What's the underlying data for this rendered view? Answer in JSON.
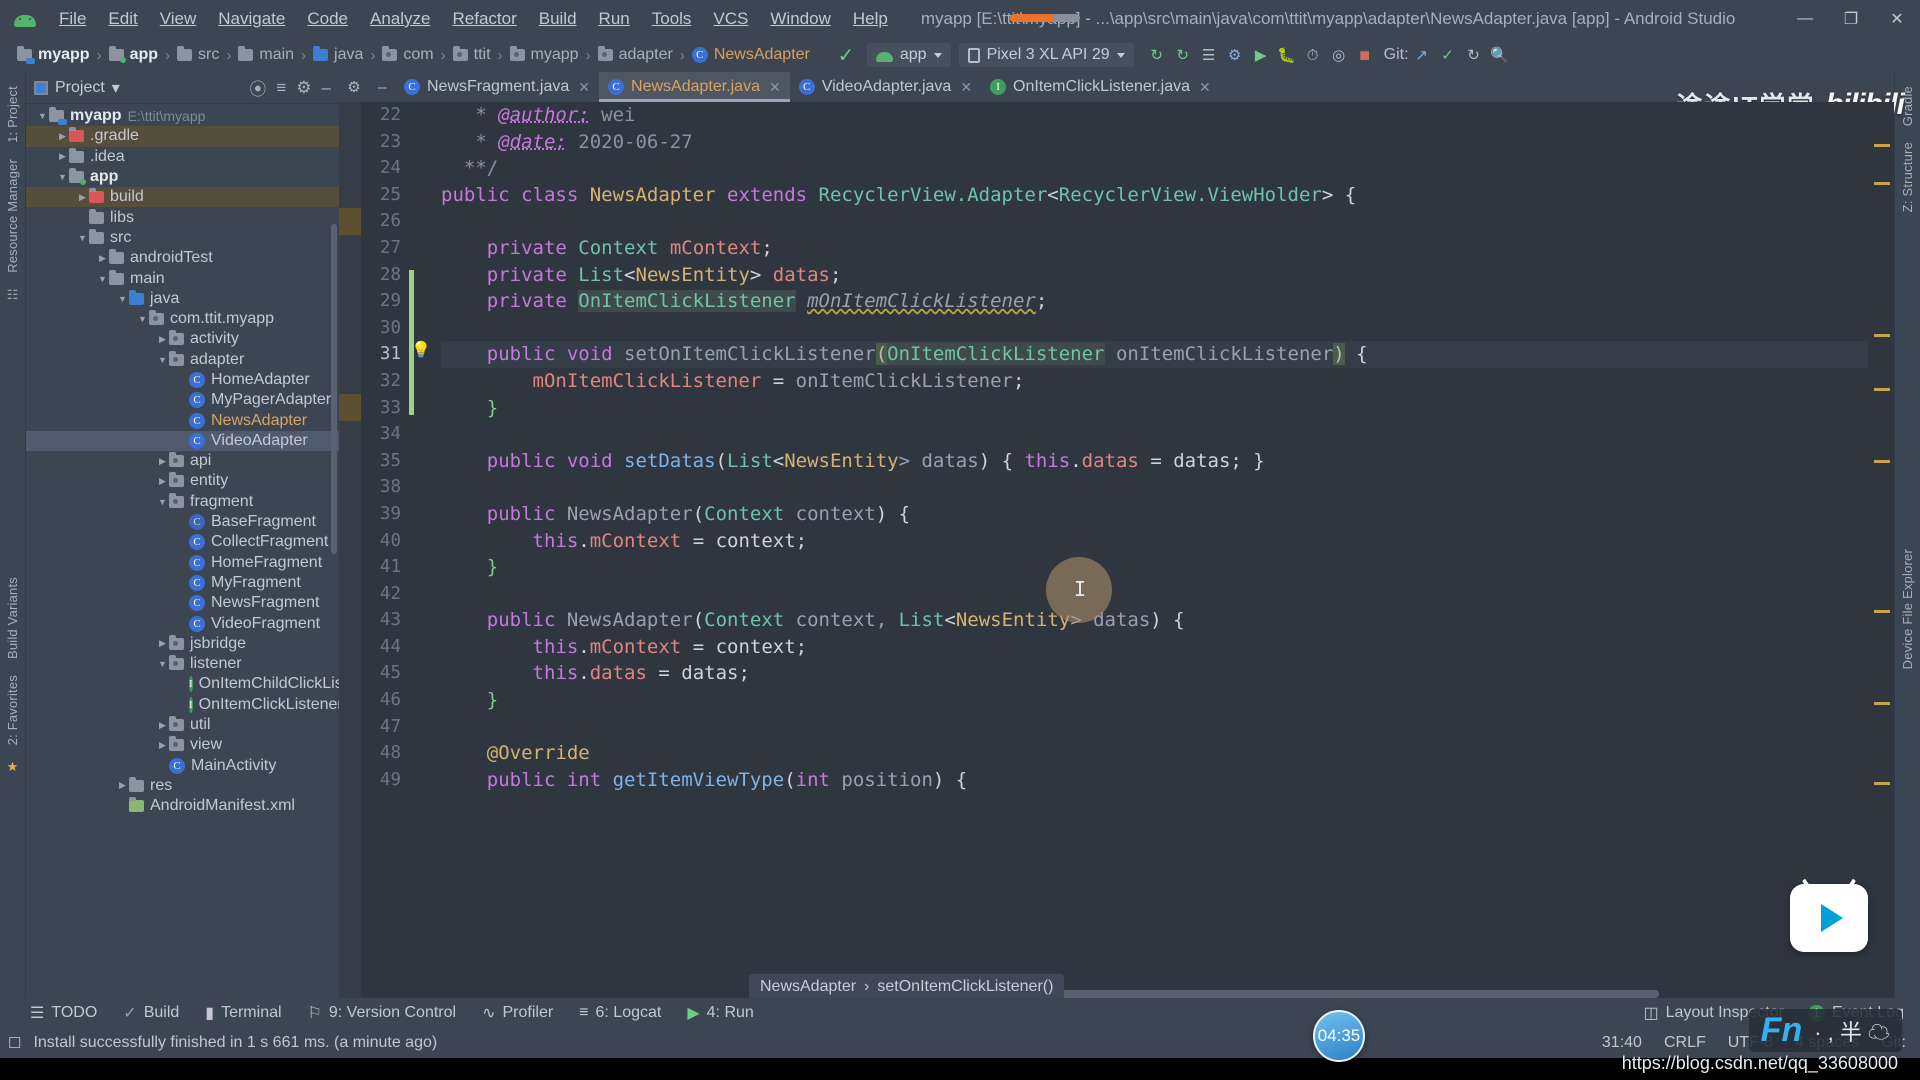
{
  "window": {
    "title": "myapp [E:\\ttit\\myapp] - ...\\app\\src\\main\\java\\com\\ttit\\myapp\\adapter\\NewsAdapter.java [app] - Android Studio",
    "minimize": "—",
    "maximize": "❐",
    "close": "✕",
    "app_icon": "android-icon"
  },
  "menu": [
    {
      "label": "File"
    },
    {
      "label": "Edit"
    },
    {
      "label": "View"
    },
    {
      "label": "Navigate"
    },
    {
      "label": "Code"
    },
    {
      "label": "Analyze"
    },
    {
      "label": "Refactor"
    },
    {
      "label": "Build"
    },
    {
      "label": "Run"
    },
    {
      "label": "Tools"
    },
    {
      "label": "VCS"
    },
    {
      "label": "Window"
    },
    {
      "label": "Help"
    }
  ],
  "navbar": {
    "crumbs": [
      {
        "label": "myapp",
        "icon": "project-folder-icon"
      },
      {
        "label": "app",
        "icon": "module-folder-icon"
      },
      {
        "label": "src",
        "icon": "folder-icon"
      },
      {
        "label": "main",
        "icon": "folder-icon"
      },
      {
        "label": "java",
        "icon": "source-folder-icon"
      },
      {
        "label": "com",
        "icon": "package-icon"
      },
      {
        "label": "ttit",
        "icon": "package-icon"
      },
      {
        "label": "myapp",
        "icon": "package-icon"
      },
      {
        "label": "adapter",
        "icon": "package-icon"
      },
      {
        "label": "NewsAdapter",
        "icon": "class-icon"
      }
    ],
    "separator": "›",
    "build_config": "app",
    "device": "Pixel 3 XL API 29",
    "git_label": "Git:",
    "icons": [
      "make-project-icon",
      "sync-gradle-icon",
      "avd-manager-icon",
      "sdk-manager-icon",
      "run-icon",
      "debug-icon",
      "profile-icon",
      "attach-debugger-icon",
      "stop-icon",
      "search-everywhere-icon",
      "settings-icon"
    ]
  },
  "tabs": [
    {
      "label": "NewsFragment.java",
      "icon": "class-icon",
      "active": false
    },
    {
      "label": "NewsAdapter.java",
      "icon": "class-icon",
      "active": true
    },
    {
      "label": "VideoAdapter.java",
      "icon": "class-icon",
      "active": false
    },
    {
      "label": "OnItemClickListener.java",
      "icon": "interface-icon",
      "active": false
    }
  ],
  "project_panel": {
    "title": "Project",
    "dropdown_caret": "▾",
    "actions": [
      "locate-icon",
      "collapse-all-icon",
      "settings-icon",
      "hide-icon"
    ],
    "tree": [
      {
        "depth": 0,
        "arrow": "▼",
        "label": "myapp",
        "path": "E:\\ttit\\myapp",
        "icon": "project-folder-icon",
        "bold": true
      },
      {
        "depth": 1,
        "arrow": "▶",
        "label": ".gradle",
        "icon": "excluded-folder-icon",
        "state": "build-hl"
      },
      {
        "depth": 1,
        "arrow": "▶",
        "label": ".idea",
        "icon": "folder-icon"
      },
      {
        "depth": 1,
        "arrow": "▼",
        "label": "app",
        "icon": "module-folder-icon",
        "bold": true
      },
      {
        "depth": 2,
        "arrow": "▶",
        "label": "build",
        "icon": "excluded-folder-icon",
        "state": "build-hl"
      },
      {
        "depth": 2,
        "arrow": "",
        "label": "libs",
        "icon": "folder-icon"
      },
      {
        "depth": 2,
        "arrow": "▼",
        "label": "src",
        "icon": "folder-icon"
      },
      {
        "depth": 3,
        "arrow": "▶",
        "label": "androidTest",
        "icon": "folder-icon"
      },
      {
        "depth": 3,
        "arrow": "▼",
        "label": "main",
        "icon": "folder-icon"
      },
      {
        "depth": 4,
        "arrow": "▼",
        "label": "java",
        "icon": "source-folder-icon"
      },
      {
        "depth": 5,
        "arrow": "▼",
        "label": "com.ttit.myapp",
        "icon": "package-icon"
      },
      {
        "depth": 6,
        "arrow": "▶",
        "label": "activity",
        "icon": "package-icon"
      },
      {
        "depth": 6,
        "arrow": "▼",
        "label": "adapter",
        "icon": "package-icon"
      },
      {
        "depth": 7,
        "arrow": "",
        "label": "HomeAdapter",
        "icon": "class-icon"
      },
      {
        "depth": 7,
        "arrow": "",
        "label": "MyPagerAdapter",
        "icon": "class-icon"
      },
      {
        "depth": 7,
        "arrow": "",
        "label": "NewsAdapter",
        "icon": "class-icon",
        "state": "open-file"
      },
      {
        "depth": 7,
        "arrow": "",
        "label": "VideoAdapter",
        "icon": "class-icon",
        "state": "selected"
      },
      {
        "depth": 6,
        "arrow": "▶",
        "label": "api",
        "icon": "package-icon"
      },
      {
        "depth": 6,
        "arrow": "▶",
        "label": "entity",
        "icon": "package-icon"
      },
      {
        "depth": 6,
        "arrow": "▼",
        "label": "fragment",
        "icon": "package-icon"
      },
      {
        "depth": 7,
        "arrow": "",
        "label": "BaseFragment",
        "icon": "abstract-class-icon"
      },
      {
        "depth": 7,
        "arrow": "",
        "label": "CollectFragment",
        "icon": "class-icon"
      },
      {
        "depth": 7,
        "arrow": "",
        "label": "HomeFragment",
        "icon": "class-icon"
      },
      {
        "depth": 7,
        "arrow": "",
        "label": "MyFragment",
        "icon": "class-icon"
      },
      {
        "depth": 7,
        "arrow": "",
        "label": "NewsFragment",
        "icon": "class-icon"
      },
      {
        "depth": 7,
        "arrow": "",
        "label": "VideoFragment",
        "icon": "class-icon"
      },
      {
        "depth": 6,
        "arrow": "▶",
        "label": "jsbridge",
        "icon": "package-icon"
      },
      {
        "depth": 6,
        "arrow": "▼",
        "label": "listener",
        "icon": "package-icon"
      },
      {
        "depth": 7,
        "arrow": "",
        "label": "OnItemChildClickListener",
        "icon": "interface-icon"
      },
      {
        "depth": 7,
        "arrow": "",
        "label": "OnItemClickListener",
        "icon": "interface-icon"
      },
      {
        "depth": 6,
        "arrow": "▶",
        "label": "util",
        "icon": "package-icon"
      },
      {
        "depth": 6,
        "arrow": "▶",
        "label": "view",
        "icon": "package-icon"
      },
      {
        "depth": 6,
        "arrow": "",
        "label": "MainActivity",
        "icon": "class-icon"
      },
      {
        "depth": 4,
        "arrow": "▶",
        "label": "res",
        "icon": "folder-icon"
      },
      {
        "depth": 4,
        "arrow": "",
        "label": "AndroidManifest.xml",
        "icon": "manifest-icon"
      }
    ]
  },
  "left_rail": [
    "1: Project",
    "Resource Manager",
    "Build Variants",
    "2: Favorites"
  ],
  "right_rail": [
    "Gradle",
    "Z: Structure",
    "Device File Explorer"
  ],
  "editor": {
    "first_line": 22,
    "lines": [
      {
        "n": 22,
        "segs": [
          {
            "t": "   * ",
            "c": "cmt"
          },
          {
            "t": "@author:",
            "c": "tag"
          },
          {
            "t": " wei",
            "c": "cmt"
          }
        ]
      },
      {
        "n": 23,
        "segs": [
          {
            "t": "   * ",
            "c": "cmt"
          },
          {
            "t": "@date:",
            "c": "tag"
          },
          {
            "t": " 2020-06-27",
            "c": "cmt"
          }
        ]
      },
      {
        "n": 24,
        "segs": [
          {
            "t": "  **/",
            "c": "cmt"
          }
        ]
      },
      {
        "n": 25,
        "segs": [
          {
            "t": "public class ",
            "c": "kw"
          },
          {
            "t": "NewsAdapter",
            "c": "cls"
          },
          {
            "t": " extends ",
            "c": "kw"
          },
          {
            "t": "RecyclerView.Adapter",
            "c": "typ"
          },
          {
            "t": "<",
            "c": "punct"
          },
          {
            "t": "RecyclerView.ViewHolder",
            "c": "typ"
          },
          {
            "t": "> {",
            "c": "punct"
          }
        ]
      },
      {
        "n": 26,
        "segs": []
      },
      {
        "n": 27,
        "segs": [
          {
            "t": "    private ",
            "c": "kw"
          },
          {
            "t": "Context",
            "c": "typ"
          },
          {
            "t": " ",
            "c": "punct"
          },
          {
            "t": "mContext",
            "c": "fld"
          },
          {
            "t": ";",
            "c": "punct"
          }
        ]
      },
      {
        "n": 28,
        "segs": [
          {
            "t": "    private ",
            "c": "kw"
          },
          {
            "t": "List",
            "c": "typ"
          },
          {
            "t": "<",
            "c": "punct"
          },
          {
            "t": "NewsEntity",
            "c": "cls"
          },
          {
            "t": "> ",
            "c": "punct"
          },
          {
            "t": "datas",
            "c": "fld"
          },
          {
            "t": ";",
            "c": "punct"
          }
        ]
      },
      {
        "n": 29,
        "segs": [
          {
            "t": "    private ",
            "c": "kw"
          },
          {
            "t": "OnItemClickListener",
            "c": "typ hl-ident"
          },
          {
            "t": " ",
            "c": "punct"
          },
          {
            "t": "mOnItemClickListener",
            "c": "varit"
          },
          {
            "t": ";",
            "c": "punct"
          }
        ]
      },
      {
        "n": 30,
        "segs": []
      },
      {
        "n": 31,
        "segs": [
          {
            "t": "    public void ",
            "c": "kw"
          },
          {
            "t": "setOnItemClickListener",
            "c": "fn"
          },
          {
            "t": "(",
            "c": "hl-paren"
          },
          {
            "t": "OnItemClickListener",
            "c": "typ hl-ident"
          },
          {
            "t": " onItemClickListener",
            "c": "var"
          },
          {
            "t": ")",
            "c": "hl-paren"
          },
          {
            "t": " {",
            "c": "punct"
          }
        ],
        "current": true
      },
      {
        "n": 32,
        "segs": [
          {
            "t": "        ",
            "c": "punct"
          },
          {
            "t": "mOnItemClickListener",
            "c": "fld"
          },
          {
            "t": " = ",
            "c": "punct"
          },
          {
            "t": "onItemClickListener",
            "c": "var"
          },
          {
            "t": ";",
            "c": "punct"
          }
        ]
      },
      {
        "n": 33,
        "segs": [
          {
            "t": "    }",
            "c": "green"
          }
        ]
      },
      {
        "n": 34,
        "segs": []
      },
      {
        "n": 35,
        "segs": [
          {
            "t": "    public void ",
            "c": "kw"
          },
          {
            "t": "setDatas",
            "c": "fn2"
          },
          {
            "t": "(",
            "c": "punct"
          },
          {
            "t": "List",
            "c": "typ"
          },
          {
            "t": "<",
            "c": "punct"
          },
          {
            "t": "NewsEntity",
            "c": "cls"
          },
          {
            "t": "> datas",
            "c": "var"
          },
          {
            "t": ") { ",
            "c": "punct"
          },
          {
            "t": "this",
            "c": "kw"
          },
          {
            "t": ".",
            "c": "punct"
          },
          {
            "t": "datas",
            "c": "fld"
          },
          {
            "t": " = datas; }",
            "c": "punct"
          }
        ]
      },
      {
        "n": 38,
        "segs": []
      },
      {
        "n": 39,
        "segs": [
          {
            "t": "    public ",
            "c": "kw"
          },
          {
            "t": "NewsAdapter",
            "c": "fn"
          },
          {
            "t": "(",
            "c": "punct"
          },
          {
            "t": "Context",
            "c": "typ"
          },
          {
            "t": " context",
            "c": "var"
          },
          {
            "t": ") {",
            "c": "punct"
          }
        ]
      },
      {
        "n": 40,
        "segs": [
          {
            "t": "        ",
            "c": "punct"
          },
          {
            "t": "this",
            "c": "kw"
          },
          {
            "t": ".",
            "c": "punct"
          },
          {
            "t": "mContext",
            "c": "fld"
          },
          {
            "t": " = context;",
            "c": "punct"
          }
        ]
      },
      {
        "n": 41,
        "segs": [
          {
            "t": "    }",
            "c": "green"
          }
        ]
      },
      {
        "n": 42,
        "segs": []
      },
      {
        "n": 43,
        "segs": [
          {
            "t": "    public ",
            "c": "kw"
          },
          {
            "t": "NewsAdapter",
            "c": "fn"
          },
          {
            "t": "(",
            "c": "punct"
          },
          {
            "t": "Context",
            "c": "typ"
          },
          {
            "t": " context, ",
            "c": "var"
          },
          {
            "t": "List",
            "c": "typ"
          },
          {
            "t": "<",
            "c": "punct"
          },
          {
            "t": "NewsEntity",
            "c": "cls"
          },
          {
            "t": "> datas",
            "c": "var"
          },
          {
            "t": ") {",
            "c": "punct"
          }
        ]
      },
      {
        "n": 44,
        "segs": [
          {
            "t": "        ",
            "c": "punct"
          },
          {
            "t": "this",
            "c": "kw"
          },
          {
            "t": ".",
            "c": "punct"
          },
          {
            "t": "mContext",
            "c": "fld"
          },
          {
            "t": " = context;",
            "c": "punct"
          }
        ]
      },
      {
        "n": 45,
        "segs": [
          {
            "t": "        ",
            "c": "punct"
          },
          {
            "t": "this",
            "c": "kw"
          },
          {
            "t": ".",
            "c": "punct"
          },
          {
            "t": "datas",
            "c": "fld"
          },
          {
            "t": " = datas;",
            "c": "punct"
          }
        ]
      },
      {
        "n": 46,
        "segs": [
          {
            "t": "    }",
            "c": "green"
          }
        ]
      },
      {
        "n": 47,
        "segs": []
      },
      {
        "n": 48,
        "segs": [
          {
            "t": "    @Override",
            "c": "cls"
          }
        ]
      },
      {
        "n": 49,
        "segs": [
          {
            "t": "    public int ",
            "c": "kw"
          },
          {
            "t": "getItemViewType",
            "c": "fn2"
          },
          {
            "t": "(",
            "c": "punct"
          },
          {
            "t": "int",
            "c": "kw"
          },
          {
            "t": " position",
            "c": "var"
          },
          {
            "t": ") {",
            "c": "punct"
          }
        ]
      }
    ],
    "breadcrumb": [
      "NewsAdapter",
      "setOnItemClickListener()"
    ],
    "breadcrumb_sep": "›"
  },
  "bottom_bar": {
    "left": [
      {
        "label": "TODO",
        "icon": "todo-icon"
      },
      {
        "label": "Build",
        "icon": "build-icon"
      },
      {
        "label": "Terminal",
        "icon": "terminal-icon"
      },
      {
        "label": "9: Version Control",
        "icon": "vcs-icon"
      },
      {
        "label": "Profiler",
        "icon": "profiler-icon"
      },
      {
        "label": "6: Logcat",
        "icon": "logcat-icon"
      },
      {
        "label": "4: Run",
        "icon": "run-icon"
      }
    ],
    "right": [
      {
        "label": "Layout Inspector",
        "icon": "layout-inspector-icon"
      },
      {
        "label": "Event Log",
        "icon": "event-log-icon",
        "badge": "1"
      }
    ]
  },
  "status_bar": {
    "message": "Install successfully finished in 1 s 661 ms. (a minute ago)",
    "message_icon": "notification-icon",
    "caret_position": "31:40",
    "line_separator": "CRLF",
    "encoding": "UTF-8",
    "indent": "4 spaces",
    "git_branch_label": "Git:"
  },
  "overlays": {
    "watermark_cn": "途途IT学堂",
    "watermark_bili": "bilibili",
    "clock": "04:35",
    "fn_key": "Fn",
    "ime_glyphs": "· , 半 ☁",
    "csdn_url": "https://blog.csdn.net/qq_33608000"
  },
  "colors": {
    "chrome": "#3c4552",
    "editor_bg": "#2f3640",
    "accent_orange": "#e8732c",
    "selection": "#515b70",
    "green_change": "#99d488"
  }
}
